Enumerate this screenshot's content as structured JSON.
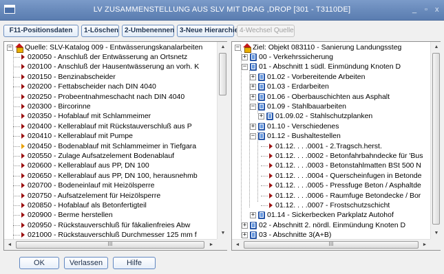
{
  "window": {
    "title": "LV ZUSAMMENSTELLUNG AUS SLV MIT DRAG ,DROP  [301 - T3110DE]",
    "minimize_glyph": "_",
    "maximize_glyph": "▫",
    "close_glyph": "x"
  },
  "toolbar": {
    "buttons": [
      {
        "label": "F11-Positionsdaten",
        "enabled": true
      },
      {
        "label": "1-Löschen",
        "enabled": true
      },
      {
        "label": "2-Umbenennen",
        "enabled": true
      },
      {
        "label": "3-Neue Hierarchie",
        "enabled": true
      },
      {
        "label": "4-Wechsel Quelle",
        "enabled": false
      }
    ]
  },
  "source_tree": {
    "root": {
      "label": "Quelle: SLV-Katalog 009 - Entwässerungskanalarbeiten",
      "expander": "−",
      "icon": "house-icon"
    },
    "items": [
      {
        "label": "020050 - Anschluß der Entwässerung an Ortsnetz",
        "icon": "arrow-icon"
      },
      {
        "label": "020100 - Anschluß der Hausentwässerung an vorh. K",
        "icon": "arrow-icon"
      },
      {
        "label": "020150 - Benzinabscheider",
        "icon": "arrow-icon"
      },
      {
        "label": "020200 - Fettabscheider nach DIN 4040",
        "icon": "arrow-icon"
      },
      {
        "label": "020250 - Probeentnahmeschacht nach DIN 4040",
        "icon": "arrow-icon"
      },
      {
        "label": "020300 - Bircorinne",
        "icon": "arrow-icon"
      },
      {
        "label": "020350 - Hofablauf mit Schlammeimer",
        "icon": "arrow-icon"
      },
      {
        "label": "020400 - Kellerablauf mit Rückstauverschluß aus P",
        "icon": "arrow-icon"
      },
      {
        "label": "020410 - Kellerablauf mit Pumpe",
        "icon": "arrow-icon"
      },
      {
        "label": "020450 - Bodenablauf mit Schlammeimer in Tiefgara",
        "icon": "arrow-icon",
        "selected": true
      },
      {
        "label": "020550 - Zulage Aufsatzelement Bodenablauf",
        "icon": "arrow-icon"
      },
      {
        "label": "020600 - Kellerablauf aus PP, DN 100",
        "icon": "arrow-icon"
      },
      {
        "label": "020650 - Kellerablauf aus PP, DN 100, herausnehmb",
        "icon": "arrow-icon"
      },
      {
        "label": "020700 - Bodeneinlauf mit Heizölsperre",
        "icon": "arrow-icon"
      },
      {
        "label": "020750 - Aufsatzelement für Heizölsperre",
        "icon": "arrow-icon"
      },
      {
        "label": "020850 - Hofablauf als Betonfertigteil",
        "icon": "arrow-icon"
      },
      {
        "label": "020900 - Berme herstellen",
        "icon": "arrow-icon"
      },
      {
        "label": "020950 - Rückstauverschluß für fäkalienfreies Abw",
        "icon": "arrow-icon"
      },
      {
        "label": "021000 - Rückstauverschluß Durchmesser 125 mm f",
        "icon": "arrow-icon"
      }
    ]
  },
  "target_tree": {
    "root": {
      "label": "Ziel: Objekt 083110 - Sanierung Landungssteg",
      "expander": "−",
      "icon": "house-icon"
    },
    "items": [
      {
        "label": "00 - Verkehrssicherung",
        "level": 1,
        "expander": "+",
        "icon": "book-icon"
      },
      {
        "label": "01 - Abschnitt 1 südl. Einmündung Knoten D",
        "level": 1,
        "expander": "−",
        "icon": "book-icon"
      },
      {
        "label": "01.02 - Vorbereitende Arbeiten",
        "level": 2,
        "expander": "+",
        "icon": "book-icon"
      },
      {
        "label": "01.03 - Erdarbeiten",
        "level": 2,
        "expander": "+",
        "icon": "book-icon"
      },
      {
        "label": "01.06 - Oberbauschichten aus Asphalt",
        "level": 2,
        "expander": "+",
        "icon": "book-icon"
      },
      {
        "label": "01.09 - Stahlbauarbeiten",
        "level": 2,
        "expander": "−",
        "icon": "book-icon"
      },
      {
        "label": "01.09.02 - Stahlschutzplanken",
        "level": 3,
        "expander": "+",
        "icon": "book-icon"
      },
      {
        "label": "01.10 - Verschiedenes",
        "level": 2,
        "expander": "+",
        "icon": "book-icon"
      },
      {
        "label": "01.12 - Bushaltestellen",
        "level": 2,
        "expander": "−",
        "icon": "book-icon"
      },
      {
        "label": "01.12. . . .0001 - 2.Tragsch.herst.",
        "level": 3,
        "icon": "arrow-icon"
      },
      {
        "label": "01.12. . . .0002 - Betonfahrbahndecke für 'Bus",
        "level": 3,
        "icon": "arrow-icon"
      },
      {
        "label": "01.12. . . .0003 - Betonstahlmatten BSt 500 N",
        "level": 3,
        "icon": "arrow-icon"
      },
      {
        "label": "01.12. . . .0004 - Querscheinfugen in Betonde",
        "level": 3,
        "icon": "arrow-icon"
      },
      {
        "label": "01.12. . . .0005 - Pressfuge Beton / Asphaltde",
        "level": 3,
        "icon": "arrow-icon"
      },
      {
        "label": "01.12. . . .0006 - Raumfuge Betondecke / Bor",
        "level": 3,
        "icon": "arrow-icon"
      },
      {
        "label": "01.12. . . .0007 - Frostschutzschicht",
        "level": 3,
        "icon": "arrow-icon"
      },
      {
        "label": "01.14 - Sickerbecken Parkplatz Autohof",
        "level": 2,
        "expander": "+",
        "icon": "book-icon"
      },
      {
        "label": "02 - Abschnitt 2. nördl. Einmündung Knoten D",
        "level": 1,
        "expander": "+",
        "icon": "book-icon"
      },
      {
        "label": "03 - Abschnitte 3(A+B)",
        "level": 1,
        "expander": "+",
        "icon": "book-icon"
      }
    ]
  },
  "scroll": {
    "up_glyph": "▲",
    "down_glyph": "▼",
    "left_glyph": "◄",
    "right_glyph": "►",
    "grip_glyph": "III",
    "source_vertical_position": 0.25,
    "target_vertical_position": 0.55
  },
  "footer": {
    "buttons": [
      {
        "label": "OK"
      },
      {
        "label": "Verlassen"
      },
      {
        "label": "Hilfe"
      }
    ]
  },
  "colors": {
    "titlebar": "#6b8cbd",
    "leaf_arrow": "#9b0f0f",
    "selected_arrow": "#e8a000",
    "folder_book": "#2756a8"
  }
}
